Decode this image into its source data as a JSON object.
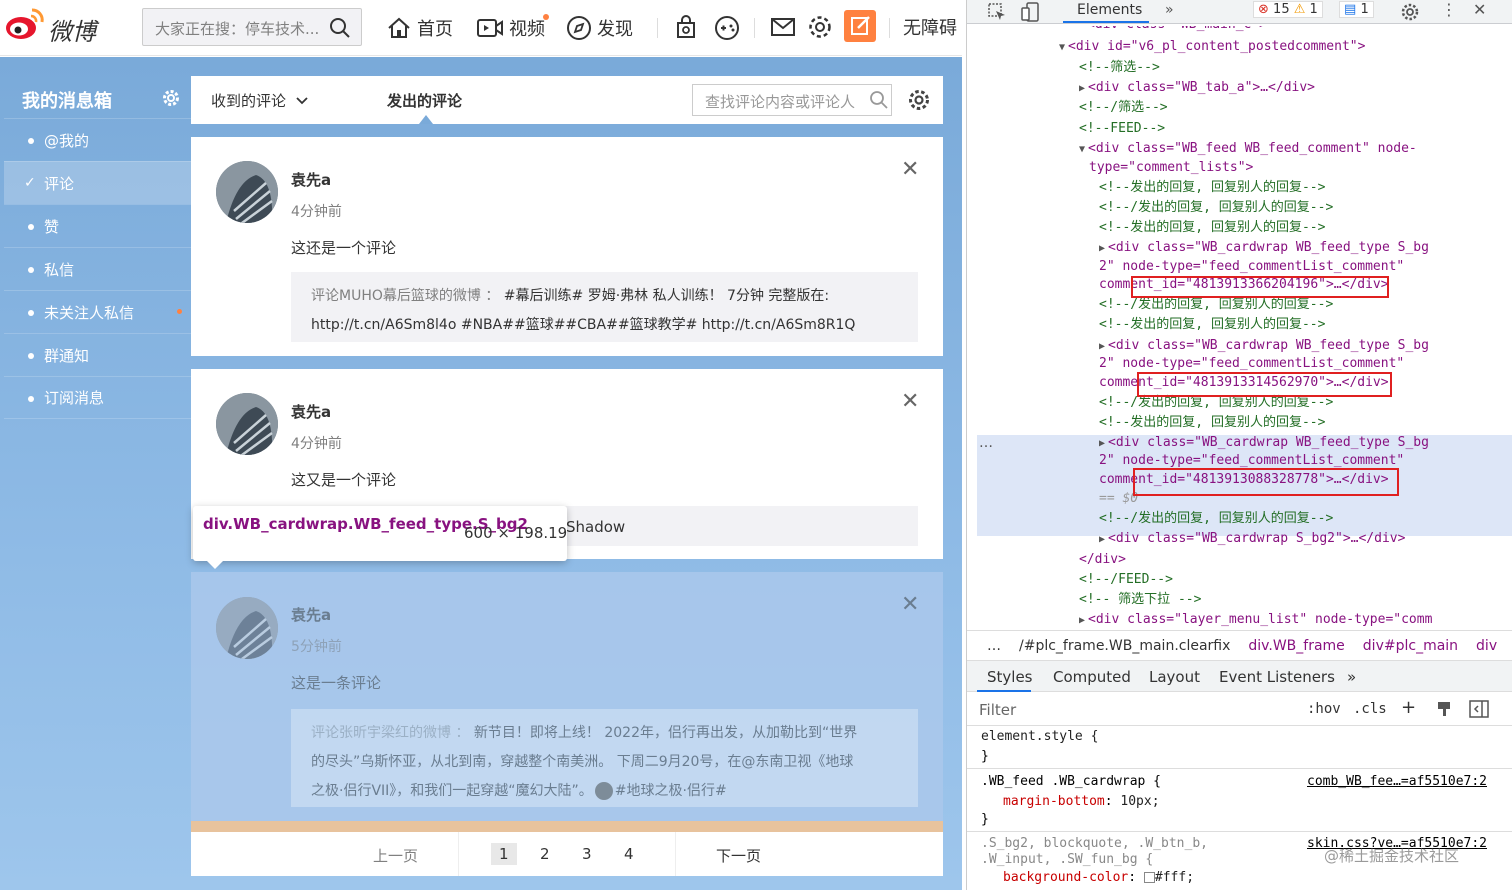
{
  "header": {
    "logo_text": "微博",
    "search_placeholder": "大家正在搜：停车技术...",
    "nav": [
      "首页",
      "视频",
      "发现"
    ],
    "accessibility": "无障碍"
  },
  "sidebar": {
    "title": "我的消息箱",
    "items": [
      "@我的",
      "评论",
      "赞",
      "私信",
      "未关注人私信",
      "群通知",
      "订阅消息"
    ]
  },
  "tabs": {
    "received": "收到的评论",
    "sent": "发出的评论",
    "search_placeholder": "查找评论内容或评论人"
  },
  "cards": [
    {
      "name": "袁先a",
      "time": "4分钟前",
      "text": "这还是一个评论",
      "quote_prefix": "评论MUHO幕后篮球的微博 ：",
      "quote_line1": "#幕后训练# 罗姆·弗林 私人训练！ 7分钟 完整版在:",
      "quote_line2": "http://t.cn/A6Sm8l4o #NBA##篮球##CBA##篮球教学# http://t.cn/A6Sm8R1Q"
    },
    {
      "name": "袁先a",
      "time": "4分钟前",
      "text": "这又是一个评论",
      "quote_tail": "Shadow"
    },
    {
      "name": "袁先a",
      "time": "5分钟前",
      "text": "这是一条评论",
      "quote_prefix": "评论张昕宇梁红的微博 ：",
      "quote_line1": "新节目！即将上线！ 2022年，侣行再出发，从加勒比到“世界",
      "quote_line2": "的尽头”乌斯怀亚，从北到南，穿越整个南美洲。 下周二9月20号，在@东南卫视《地球",
      "quote_line3": "之极·侣行VII》，和我们一起穿越“魔幻大陆”。",
      "quote_tag": "#地球之极·侣行#"
    }
  ],
  "tooltip": {
    "selector": "div.WB_cardwrap.WB_feed_type.S_bg2",
    "size": "600 × 198.19"
  },
  "pager": {
    "prev": "上一页",
    "pages": [
      "1",
      "2",
      "3",
      "4"
    ],
    "next": "下一页"
  },
  "devtools": {
    "tab_elements": "Elements",
    "errors": "15",
    "warnings": "1",
    "messages": "1",
    "dom_lines": [
      {
        "indent": 8,
        "tri": "▼",
        "html": "<div id=\"v6_pl_content_postedcomment\">"
      },
      {
        "indent": 10,
        "tri": "",
        "html": "<!--筛选-->",
        "kind": "cm"
      },
      {
        "indent": 10,
        "tri": "▶",
        "html": "<div class=\"WB_tab_a\">…</div>"
      },
      {
        "indent": 10,
        "tri": "",
        "html": "<!--/筛选-->",
        "kind": "cm"
      },
      {
        "indent": 10,
        "tri": "",
        "html": "<!--FEED-->",
        "kind": "cm"
      },
      {
        "indent": 10,
        "tri": "▼",
        "html": "<div class=\"WB_feed WB_feed_comment\" node-"
      },
      {
        "indent": 11,
        "tri": "",
        "html": "type=\"comment_lists\">"
      },
      {
        "indent": 12,
        "tri": "",
        "html": "<!--发出的回复, 回复别人的回复-->",
        "kind": "cm"
      },
      {
        "indent": 12,
        "tri": "",
        "html": "<!--/发出的回复, 回复别人的回复-->",
        "kind": "cm"
      },
      {
        "indent": 12,
        "tri": "",
        "html": "<!--发出的回复, 回复别人的回复-->",
        "kind": "cm"
      },
      {
        "indent": 12,
        "tri": "▶",
        "html": "<div class=\"WB_cardwrap WB_feed_type S_bg"
      },
      {
        "indent": 12,
        "tri": "",
        "html": "2\" node-type=\"feed_commentList_comment\""
      },
      {
        "indent": 12,
        "tri": "",
        "html": "comment_id=\"4813913366204196\">…</div>"
      },
      {
        "indent": 12,
        "tri": "",
        "html": "<!--/发出的回复, 回复别人的回复-->",
        "kind": "cm"
      },
      {
        "indent": 12,
        "tri": "",
        "html": "<!--发出的回复, 回复别人的回复-->",
        "kind": "cm"
      },
      {
        "indent": 12,
        "tri": "▶",
        "html": "<div class=\"WB_cardwrap WB_feed_type S_bg"
      },
      {
        "indent": 12,
        "tri": "",
        "html": "2\" node-type=\"feed_commentList_comment\""
      },
      {
        "indent": 12,
        "tri": "",
        "html": "comment_id=\"4813913314562970\">…</div>"
      },
      {
        "indent": 12,
        "tri": "",
        "html": "<!--/发出的回复, 回复别人的回复-->",
        "kind": "cm"
      },
      {
        "indent": 12,
        "tri": "",
        "html": "<!--发出的回复, 回复别人的回复-->",
        "kind": "cm"
      },
      {
        "indent": 12,
        "tri": "▶",
        "html": "<div class=\"WB_cardwrap WB_feed_type S_bg"
      },
      {
        "indent": 12,
        "tri": "",
        "html": "2\" node-type=\"feed_commentList_comment\""
      },
      {
        "indent": 12,
        "tri": "",
        "html": "comment_id=\"4813913088328778\">…</div>"
      },
      {
        "indent": 12,
        "tri": "",
        "html": "== $0",
        "kind": "dim"
      },
      {
        "indent": 12,
        "tri": "",
        "html": "<!--/发出的回复, 回复别人的回复-->",
        "kind": "cm"
      },
      {
        "indent": 12,
        "tri": "▶",
        "html": "<div class=\"WB_cardwrap S_bg2\">…</div>"
      },
      {
        "indent": 10,
        "tri": "",
        "html": "</div>"
      },
      {
        "indent": 10,
        "tri": "",
        "html": "<!--/FEED-->",
        "kind": "cm"
      },
      {
        "indent": 10,
        "tri": "",
        "html": "<!-- 筛选下拉 -->",
        "kind": "cm"
      },
      {
        "indent": 10,
        "tri": "▶",
        "html": "<div class=\"layer_menu_list\" node-type=\"comm"
      }
    ],
    "breadcrumbs": [
      "…",
      "/#plc_frame.WB_main.clearfix",
      "div.WB_frame",
      "div#plc_main",
      "div",
      "…"
    ],
    "style_tabs": [
      "Styles",
      "Computed",
      "Layout",
      "Event Listeners",
      "»"
    ],
    "filter_placeholder": "Filter",
    "filter_hov": ":hov",
    "filter_cls": ".cls",
    "rules": [
      {
        "selector": "element.style {",
        "source": "",
        "props": [],
        "close": "}"
      },
      {
        "selector": ".WB_feed .WB_cardwrap {",
        "source": "comb_WB_fee…=af5510e7:2",
        "props": [
          [
            "margin-bottom",
            "10px;"
          ]
        ],
        "close": "}"
      },
      {
        "selector": ".S_bg2, blockquote, .W_btn_b,",
        "selector2": ".W_input, .SW_fun_bg {",
        "source": "skin.css?ve…=af5510e7:2",
        "props": [
          [
            "background-color",
            "#fff;"
          ]
        ],
        "close": ""
      }
    ]
  },
  "watermark": "@稀土掘金技术社区",
  "colors": {
    "weibo_orange": "#ff8140",
    "page_blue": "#7aaad9",
    "devtools_accent": "#1a73e8",
    "highlight_red": "#e02020"
  }
}
